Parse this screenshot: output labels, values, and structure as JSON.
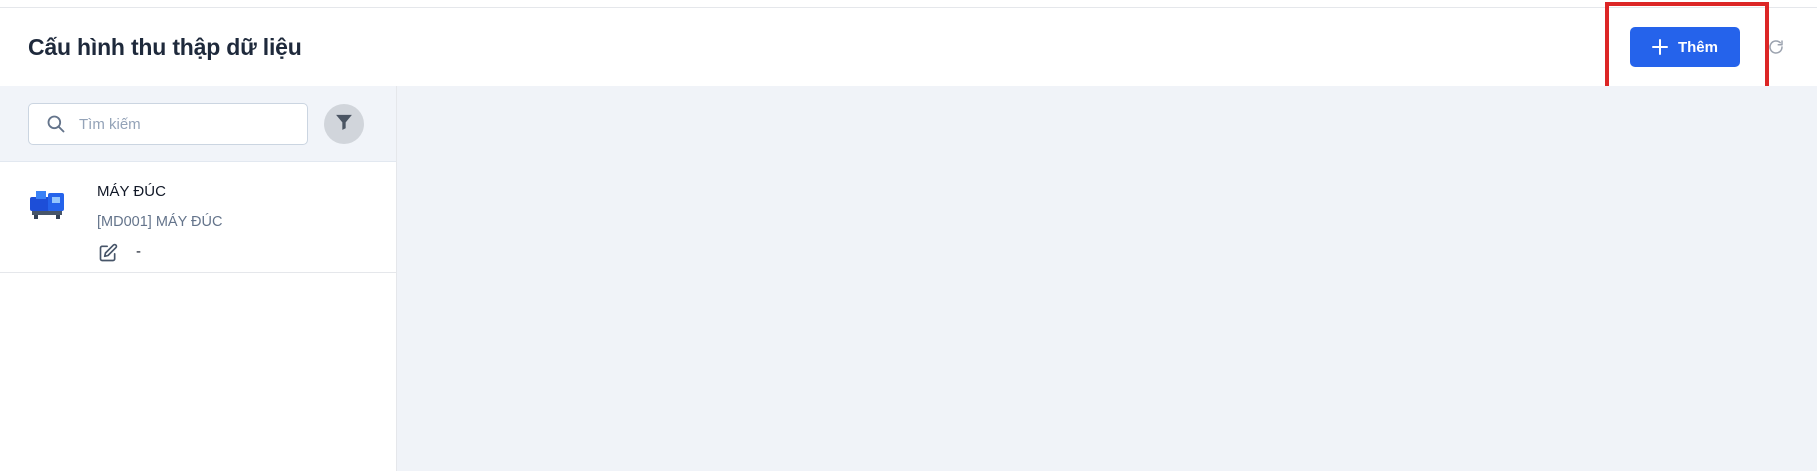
{
  "header": {
    "title": "Cấu hình thu thập dữ liệu",
    "add_button_label": "Thêm",
    "add_icon": "plus-icon",
    "refresh_icon": "refresh-icon"
  },
  "sidebar": {
    "search": {
      "placeholder": "Tìm kiếm",
      "value": "",
      "icon": "search-icon"
    },
    "filter_icon": "filter-icon",
    "items": [
      {
        "title": "MÁY ĐÚC",
        "subtitle": "[MD001] MÁY ĐÚC",
        "meta": "-",
        "thumbnail": "machine-image",
        "edit_icon": "edit-icon"
      }
    ]
  },
  "colors": {
    "primary": "#2563eb",
    "highlight": "#dc2626",
    "panel_bg": "#f0f3f8",
    "title_text": "#1e293b",
    "muted_text": "#64748b"
  }
}
